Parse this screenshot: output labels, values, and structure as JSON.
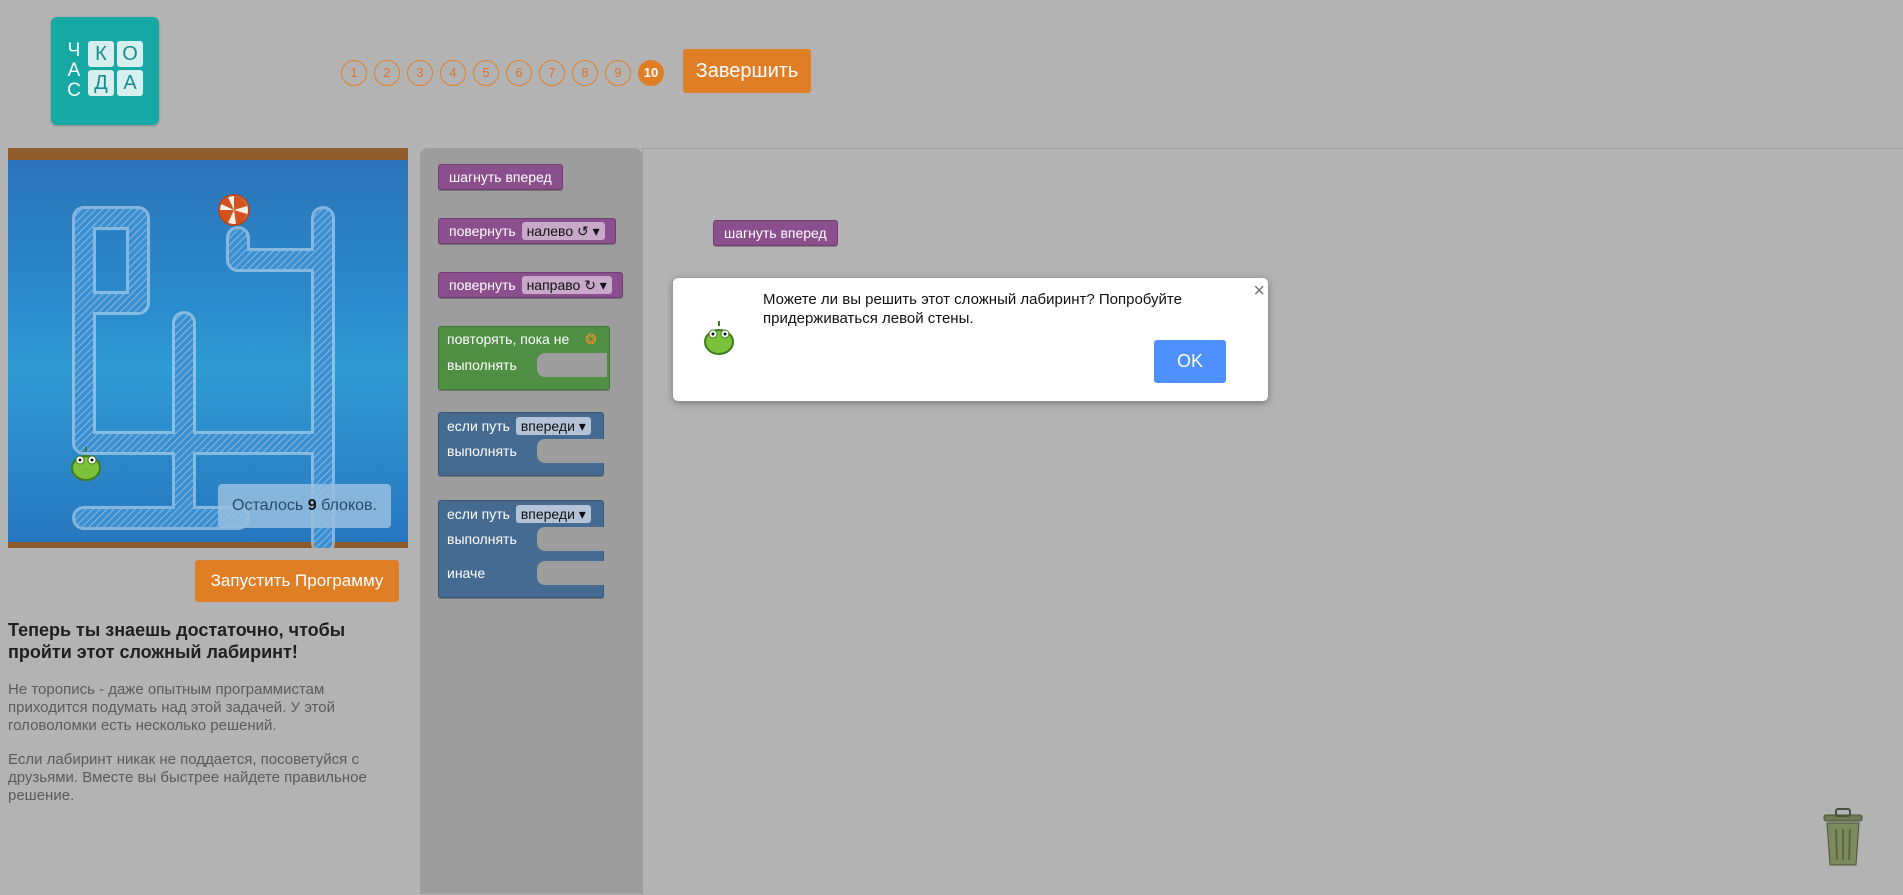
{
  "logo": {
    "vertical": [
      "Ч",
      "А",
      "С"
    ],
    "tiles": [
      "К",
      "О",
      "Д",
      "А"
    ]
  },
  "progress": {
    "levels": [
      "1",
      "2",
      "3",
      "4",
      "5",
      "6",
      "7",
      "8",
      "9",
      "10"
    ],
    "current": "10"
  },
  "header": {
    "finish_label": "Завершить"
  },
  "maze": {
    "remaining_prefix": "Осталось",
    "remaining_count": "9",
    "remaining_suffix": "блоков."
  },
  "run_label": "Запустить Программу",
  "instructions": {
    "title": "Теперь ты знаешь достаточно, чтобы пройти этот сложный лабиринт!",
    "p1": "Не торопись - даже опытным программистам приходится подумать над этой задачей. У этой головоломки есть несколько решений.",
    "p2": "Если лабиринт никак не поддается, посоветуйся с друзьями. Вместе вы быстрее найдете правильное решение."
  },
  "toolbox": {
    "move_forward": "шагнуть вперед",
    "turn_left": {
      "label": "повернуть",
      "option": "налево ↺"
    },
    "turn_right": {
      "label": "повернуть",
      "option": "направо ↻"
    },
    "repeat_until": {
      "label": "повторять, пока не",
      "do": "выполнять"
    },
    "if_path": {
      "label": "если путь",
      "option": "впереди",
      "do": "выполнять"
    },
    "if_else": {
      "label": "если путь",
      "option": "впереди",
      "do": "выполнять",
      "else": "иначе"
    }
  },
  "workspace": {
    "block": "шагнуть вперед"
  },
  "dialog": {
    "message": "Можете ли вы решить этот сложный лабиринт? Попробуйте придерживаться левой стены.",
    "ok_label": "OK",
    "close": "×"
  },
  "colors": {
    "orange": "#e07e26",
    "teal": "#16a8a2",
    "purple": "#8a4f8c",
    "green": "#4f8f44",
    "blue": "#466b93",
    "ok": "#4d90fe"
  }
}
